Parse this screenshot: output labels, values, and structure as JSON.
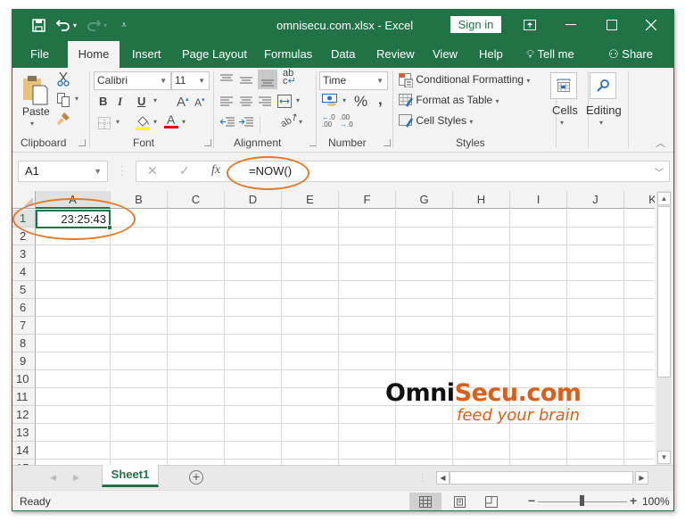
{
  "titlebar": {
    "file_name": "omnisecu.com.xlsx  -  Excel",
    "sign_in_label": "Sign in",
    "icons": [
      "save-icon",
      "undo-icon",
      "redo-icon",
      "customize-qat-icon",
      "ribbon-display-options-icon",
      "minimize-icon",
      "maximize-icon",
      "close-icon"
    ]
  },
  "menu": {
    "tabs": [
      {
        "label": "File"
      },
      {
        "label": "Home",
        "active": true
      },
      {
        "label": "Insert"
      },
      {
        "label": "Page Layout"
      },
      {
        "label": "Formulas"
      },
      {
        "label": "Data"
      },
      {
        "label": "Review"
      },
      {
        "label": "View"
      },
      {
        "label": "Help"
      }
    ],
    "tell_me": "Tell me",
    "share": "Share"
  },
  "ribbon": {
    "clipboard": {
      "label": "Clipboard",
      "paste": "Paste"
    },
    "font": {
      "label": "Font",
      "font_name": "Calibri",
      "font_size": "11",
      "bold": "B",
      "italic": "I",
      "underline": "U",
      "highlight_color": "#ffff00",
      "font_color": "#e00000"
    },
    "alignment": {
      "label": "Alignment"
    },
    "number": {
      "label": "Number",
      "format": "Time",
      "percent": "%",
      "comma": ","
    },
    "styles": {
      "label": "Styles",
      "conditional_formatting": "Conditional Formatting",
      "format_as_table": "Format as Table",
      "cell_styles": "Cell Styles"
    },
    "cells": {
      "label": "Cells"
    },
    "editing": {
      "label": "Editing"
    }
  },
  "formula_bar": {
    "name_box": "A1",
    "cancel": "✕",
    "enter": "✓",
    "fx": "fx",
    "formula": "=NOW()"
  },
  "grid": {
    "columns": [
      "A",
      "B",
      "C",
      "D",
      "E",
      "F",
      "G",
      "H",
      "I",
      "J",
      "K"
    ],
    "rows": [
      "1",
      "2",
      "3",
      "4",
      "5",
      "6",
      "7",
      "8",
      "9",
      "10",
      "11",
      "12",
      "13",
      "14"
    ],
    "selected_cell": "A1",
    "cells": {
      "A1": "23:25:43"
    }
  },
  "sheets": {
    "tabs": [
      {
        "label": "Sheet1",
        "active": true
      }
    ],
    "add_label": "+"
  },
  "status": {
    "text": "Ready",
    "zoom_level": "100%",
    "zoom_fraction": 0.5
  },
  "watermark": {
    "brand_part1": "Omni",
    "brand_part2": "Secu.com",
    "tagline": "feed your brain"
  },
  "colors": {
    "accent": "#217346",
    "annotation": "#e07a2c"
  }
}
